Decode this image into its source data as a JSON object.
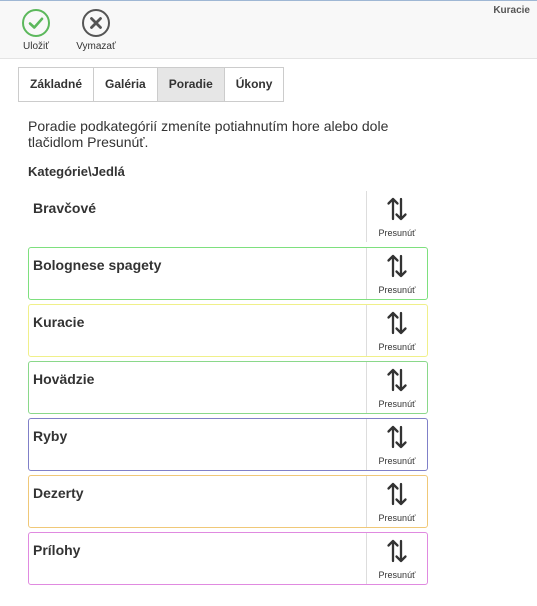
{
  "toolbar": {
    "save_label": "Uložiť",
    "clear_label": "Vymazať",
    "save_color": "#5cb85c",
    "clear_color": "#555555"
  },
  "page_heading": "Kuracie",
  "tabs": [
    {
      "label": "Základné",
      "active": false
    },
    {
      "label": "Galéria",
      "active": false
    },
    {
      "label": "Poradie",
      "active": true
    },
    {
      "label": "Úkony",
      "active": false
    }
  ],
  "intro_text": "Poradie podkategórií zmeníte potiahnutím hore alebo dole tlačidlom Presunúť.",
  "section_title": "Kategórie\\Jedlá",
  "move_label": "Presunúť",
  "items": [
    {
      "name": "Bravčové",
      "border_color": "transparent"
    },
    {
      "name": "Bolognese spagety",
      "border_color": "#7ee07e"
    },
    {
      "name": "Kuracie",
      "border_color": "#f0f08a"
    },
    {
      "name": "Hovädzie",
      "border_color": "#8ad88a"
    },
    {
      "name": "Ryby",
      "border_color": "#8080c8"
    },
    {
      "name": "Dezerty",
      "border_color": "#f0c878"
    },
    {
      "name": "Prílohy",
      "border_color": "#e08ae0"
    }
  ]
}
